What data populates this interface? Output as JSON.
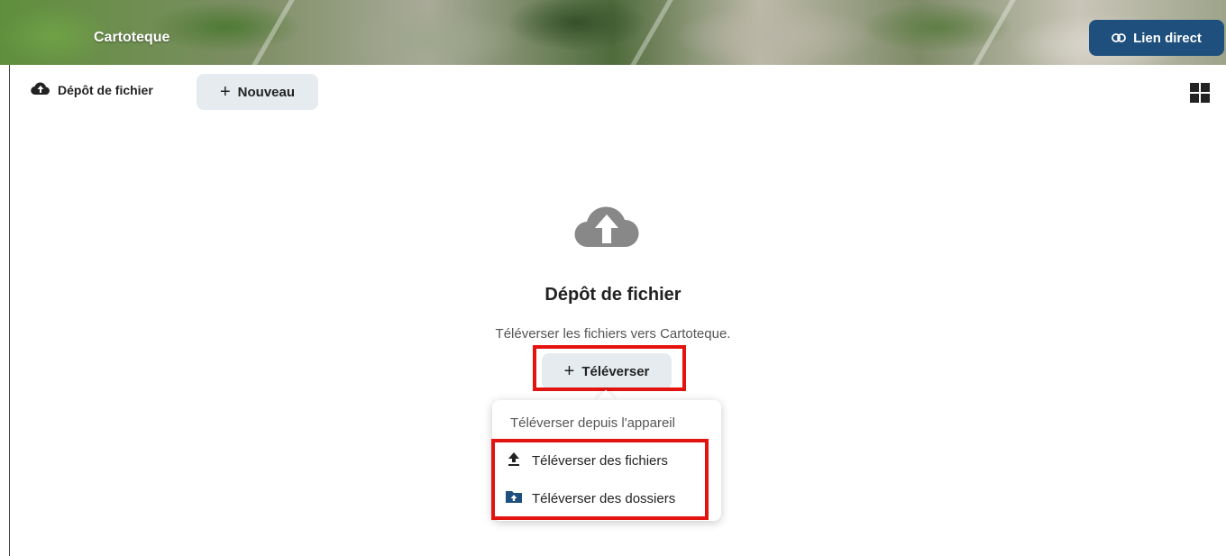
{
  "header": {
    "app_title": "Cartoteque",
    "direct_link_label": "Lien direct"
  },
  "toolbar": {
    "breadcrumb_label": "Dépôt de fichier",
    "new_label": "Nouveau"
  },
  "empty_state": {
    "title": "Dépôt de fichier",
    "description": "Téléverser les fichiers vers Cartoteque.",
    "upload_label": "Téléverser"
  },
  "upload_menu": {
    "header": "Téléverser depuis l'appareil",
    "items": [
      {
        "label": "Téléverser des fichiers",
        "icon": "upload-icon"
      },
      {
        "label": "Téléverser des dossiers",
        "icon": "folder-upload-icon"
      }
    ]
  },
  "colors": {
    "accent": "#1e4f7d",
    "button_bg": "#e6ebef",
    "highlight": "#e3130f"
  }
}
